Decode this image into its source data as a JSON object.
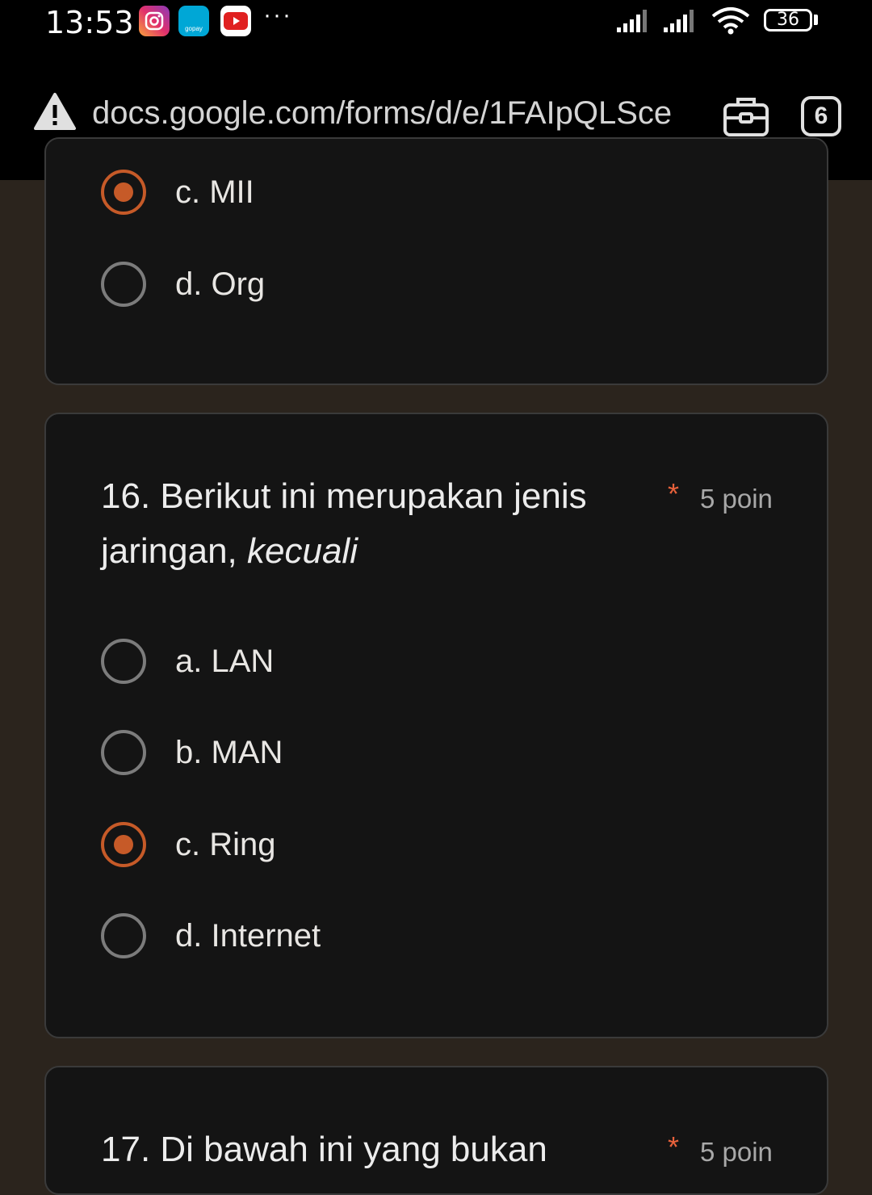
{
  "status_bar": {
    "time": "13:53",
    "notification_icons": [
      "instagram-icon",
      "gopay-icon",
      "youtube-icon"
    ],
    "gopay_label": "gopay",
    "more": "···",
    "battery": "36"
  },
  "browser": {
    "url": "docs.google.com/forms/d/e/1FAIpQLSce",
    "tab_count": "6"
  },
  "prev_question": {
    "options": [
      {
        "label": "c. MII",
        "selected": true
      },
      {
        "label": "d. Org",
        "selected": false
      }
    ]
  },
  "question16": {
    "title_main": "16. Berikut ini merupakan jenis jaringan, ",
    "title_emph": "kecuali",
    "required_mark": "*",
    "points": "5 poin",
    "options": [
      {
        "label": "a. LAN",
        "selected": false
      },
      {
        "label": "b. MAN",
        "selected": false
      },
      {
        "label": "c. Ring",
        "selected": true
      },
      {
        "label": "d. Internet",
        "selected": false
      }
    ]
  },
  "question17": {
    "title_partial": "17. Di bawah ini yang bukan",
    "required_mark": "*",
    "points": "5 poin"
  },
  "colors": {
    "page_background": "#2b241d",
    "card_background": "#141414",
    "selected_accent": "#c65a28",
    "required_star": "#e8613b"
  }
}
